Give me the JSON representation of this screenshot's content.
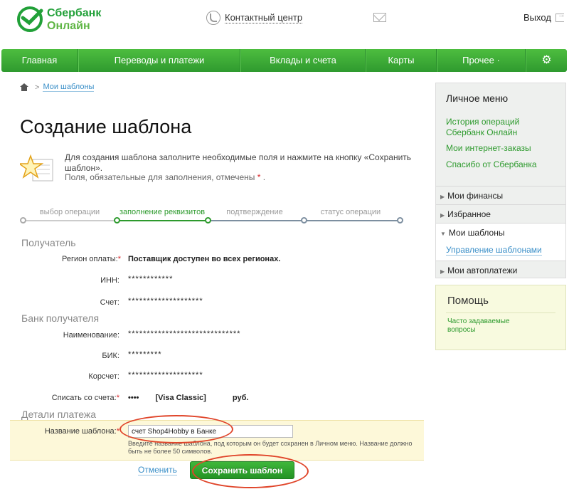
{
  "header": {
    "logo_line1": "Сбербанк",
    "logo_line2": "Онлайн",
    "contact_label": "Контактный центр",
    "exit_label": "Выход"
  },
  "nav": {
    "items": [
      "Главная",
      "Переводы и платежи",
      "Вклады и счета",
      "Карты",
      "Прочее ·"
    ]
  },
  "breadcrumb": {
    "current": "Мои шаблоны"
  },
  "page": {
    "title": "Создание шаблона",
    "intro_text": "Для создания шаблона заполните необходимые поля и нажмите на кнопку «Сохранить шаблон».",
    "intro_note": "Поля, обязательные для заполнения, отмечены",
    "required_mark": "*",
    "intro_note_end": "."
  },
  "steps": [
    "выбор операции",
    "заполнение реквизитов",
    "подтверждение",
    "статус операции"
  ],
  "form": {
    "recipient_section": "Получатель",
    "region_label": "Регион оплаты:",
    "region_value": "Поставщик доступен во всех регионах.",
    "inn_label": "ИНН:",
    "inn_value": "************",
    "account_label": "Счет:",
    "account_value": "********************",
    "bank_section": "Банк получателя",
    "name_label": "Наименование:",
    "name_value": "******************************",
    "bik_label": "БИК:",
    "bik_value": "*********",
    "corr_label": "Корсчет:",
    "corr_value": "********************",
    "debit_label": "Списать со счета:",
    "debit_card": "••••",
    "debit_type": "[Visa Classic]",
    "debit_currency": "руб.",
    "details_section": "Детали платежа",
    "template_label": "Название шаблона:",
    "template_value": "счет Shop4Hobby в Банке",
    "hint": "Введите название шаблона, под которым он будет сохранен в Личном меню. Название должно быть не более 50 символов.",
    "cancel_label": "Отменить",
    "save_label": "Сохранить шаблон"
  },
  "sidebar": {
    "title": "Личное меню",
    "links": [
      "История операций Сбербанк Онлайн",
      "Мои интернет-заказы",
      "Спасибо от Сбербанка"
    ],
    "groups": [
      "Мои финансы",
      "Избранное",
      "Мои шаблоны",
      "Мои автоплатежи"
    ],
    "templates_sublink": "Управление шаблонами",
    "help_title": "Помощь",
    "help_link": "Часто задаваемые вопросы"
  },
  "colors": {
    "brand_green": "#21a038",
    "link_blue": "#3a8fc8",
    "required_red": "#d9262a",
    "highlight_yellow": "#fdf8d9",
    "annotation_red": "#e0452a"
  }
}
